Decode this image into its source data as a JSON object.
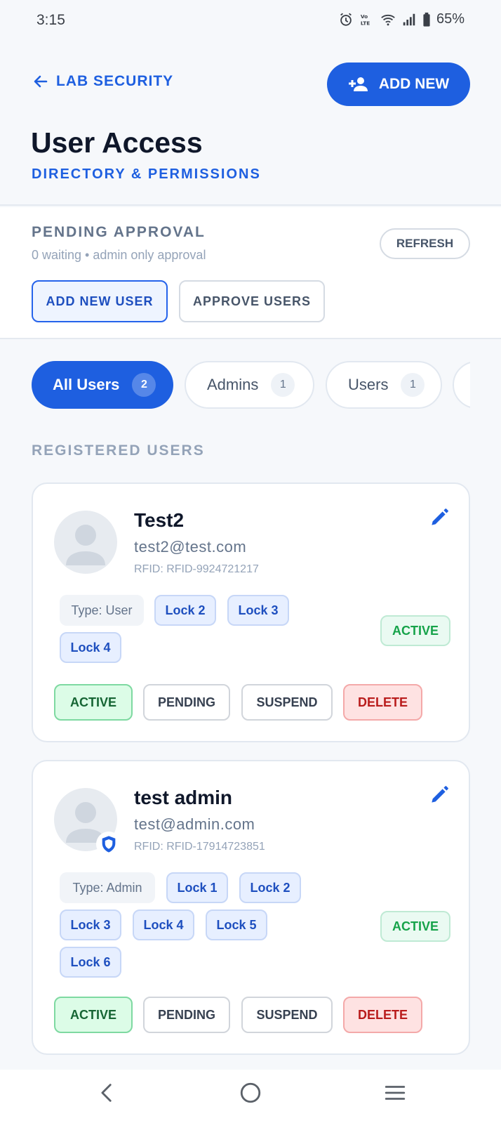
{
  "status_bar": {
    "time": "3:15",
    "battery": "65%",
    "icons": [
      "alarm-icon",
      "volte-icon",
      "wifi-icon",
      "signal-icon",
      "battery-icon"
    ]
  },
  "header": {
    "back_label": "LAB SECURITY",
    "add_new_label": "ADD NEW",
    "title": "User Access",
    "subtitle": "DIRECTORY & PERMISSIONS"
  },
  "pending": {
    "title": "PENDING APPROVAL",
    "subtitle": "0 waiting • admin only approval",
    "refresh_label": "REFRESH",
    "add_user_label": "ADD NEW USER",
    "approve_label": "APPROVE USERS"
  },
  "tabs": [
    {
      "label": "All Users",
      "count": "2",
      "active": true
    },
    {
      "label": "Admins",
      "count": "1",
      "active": false
    },
    {
      "label": "Users",
      "count": "1",
      "active": false
    }
  ],
  "section_title": "REGISTERED USERS",
  "users": [
    {
      "name": "Test2",
      "email": "test2@test.com",
      "rfid": "RFID: RFID-9924721217",
      "type": "Type: User",
      "locks": [
        "Lock 2",
        "Lock 3",
        "Lock 4"
      ],
      "status": "ACTIVE",
      "is_admin": false
    },
    {
      "name": "test admin",
      "email": "test@admin.com",
      "rfid": "RFID: RFID-17914723851",
      "type": "Type: Admin",
      "locks": [
        "Lock 1",
        "Lock 2",
        "Lock 3",
        "Lock 4",
        "Lock 5",
        "Lock 6"
      ],
      "status": "ACTIVE",
      "is_admin": true
    }
  ],
  "actions": {
    "active": "ACTIVE",
    "pending": "PENDING",
    "suspend": "SUSPEND",
    "delete": "DELETE"
  },
  "colors": {
    "accent": "#1e5fe0",
    "success": "#16a34a",
    "danger": "#b91c1c"
  }
}
